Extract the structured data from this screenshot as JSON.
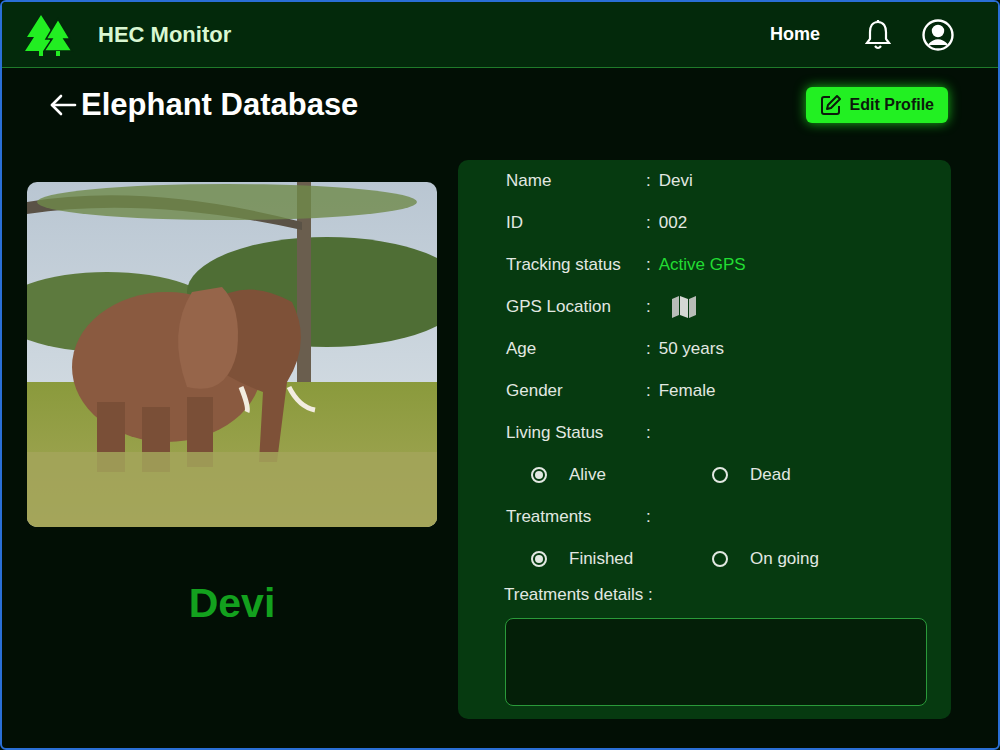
{
  "app": {
    "title": "HEC Monitor"
  },
  "nav": {
    "home": "Home"
  },
  "page": {
    "title": "Elephant Database",
    "edit_button": "Edit Profile"
  },
  "elephant": {
    "display_name": "Devi"
  },
  "fields": [
    {
      "kind": "text",
      "label": "Name",
      "sep": ":",
      "value": "Devi"
    },
    {
      "kind": "text",
      "label": "ID",
      "sep": ":",
      "value": "002"
    },
    {
      "kind": "status",
      "label": "Tracking status",
      "sep": ":",
      "value": "Active GPS"
    },
    {
      "kind": "map",
      "label": "GPS Location",
      "sep": ":"
    },
    {
      "kind": "text",
      "label": "Age",
      "sep": ":",
      "value": "50 years"
    },
    {
      "kind": "text",
      "label": "Gender",
      "sep": ":",
      "value": "Female"
    },
    {
      "kind": "radio",
      "label": "Living Status",
      "sep": ":",
      "options": [
        {
          "label": "Alive",
          "selected": true
        },
        {
          "label": "Dead",
          "selected": false
        }
      ]
    },
    {
      "kind": "radio",
      "label": "Treatments",
      "sep": ":",
      "options": [
        {
          "label": "Finished",
          "selected": true
        },
        {
          "label": "On going",
          "selected": false
        }
      ]
    },
    {
      "kind": "textarea",
      "label": "Treatments details :"
    }
  ]
}
